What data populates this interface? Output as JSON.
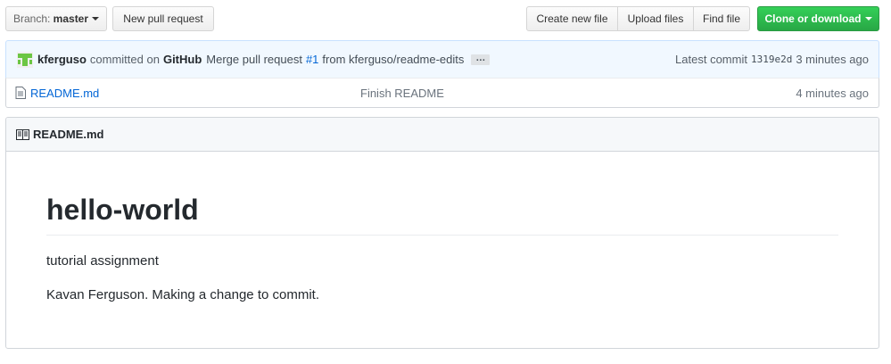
{
  "toolbar": {
    "branch_prefix": "Branch:",
    "branch_name": "master",
    "new_pull_request": "New pull request",
    "create_new_file": "Create new file",
    "upload_files": "Upload files",
    "find_file": "Find file",
    "clone_or_download": "Clone or download"
  },
  "commit": {
    "author": "kferguso",
    "committed_on": "committed on",
    "platform": "GitHub",
    "message_prefix": "Merge pull request",
    "pr_number": "#1",
    "message_suffix": "from kferguso/readme-edits",
    "ellipsis": "…",
    "latest_label": "Latest commit",
    "sha": "1319e2d",
    "time": "3 minutes ago"
  },
  "files": [
    {
      "name": "README.md",
      "message": "Finish README",
      "age": "4 minutes ago"
    }
  ],
  "readme": {
    "header": "README.md",
    "title": "hello-world",
    "paragraphs": [
      "tutorial assignment",
      "Kavan Ferguson. Making a change to commit."
    ]
  },
  "colors": {
    "link": "#0366d6",
    "green_start": "#34d058",
    "green_end": "#28a745",
    "avatar": "#6cc644"
  }
}
